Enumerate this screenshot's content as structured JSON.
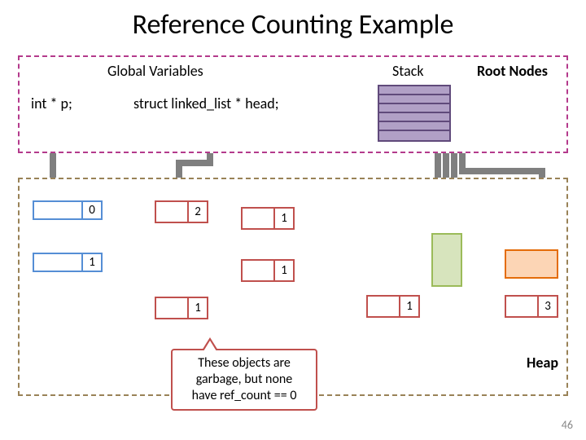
{
  "title": "Reference Counting Example",
  "root_panel": {
    "global_label": "Global Variables",
    "stack_label": "Stack",
    "root_nodes_label": "Root Nodes",
    "var_p": "int * p;",
    "var_head": "struct linked_list * head;"
  },
  "heap": {
    "label": "Heap",
    "nodes": {
      "n0": "0",
      "n1_left": "1",
      "n2": "2",
      "n1_mid_a": "1",
      "n1_mid_b": "1",
      "n1_below": "1",
      "n1_right": "1",
      "n3": "3"
    }
  },
  "callout": {
    "line1": "These objects are",
    "line2": "garbage, but none",
    "line3": "have ref_count == 0"
  },
  "page_number": "46"
}
